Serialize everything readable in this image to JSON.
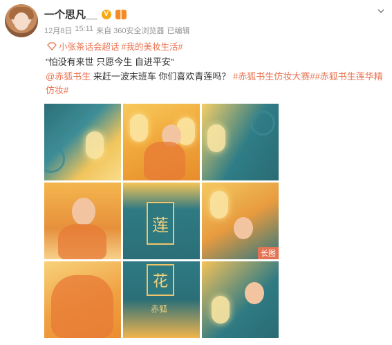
{
  "post": {
    "username": "一个思凡__",
    "date": "12月8日",
    "time": "15:11",
    "source": "来自 360安全浏览器",
    "edited": "已编辑",
    "supertopic": "小张茶话会超话",
    "topic1": "#我的美妆生活#",
    "line1": "\"怕没有来世 只愿今生 自进平安\"",
    "mention": "@赤狐书生",
    "line2_text": " 来赶一波末班车 你们喜欢青莲吗？ ",
    "topic2": "#赤狐书生仿妆大赛#",
    "topic3": "#赤狐书生莲华精仿妆#"
  },
  "images": {
    "title_char_1": "莲",
    "title_char_2": "花",
    "seal_text": "赤狐",
    "long_badge": "长图"
  },
  "colors": {
    "link": "#eb7350",
    "teal": "#2e7880",
    "gold": "#f1c46a"
  },
  "icons": [
    "avatar",
    "v-verified-icon",
    "gift-badge-icon",
    "chevron-down-icon",
    "super-topic-icon"
  ]
}
